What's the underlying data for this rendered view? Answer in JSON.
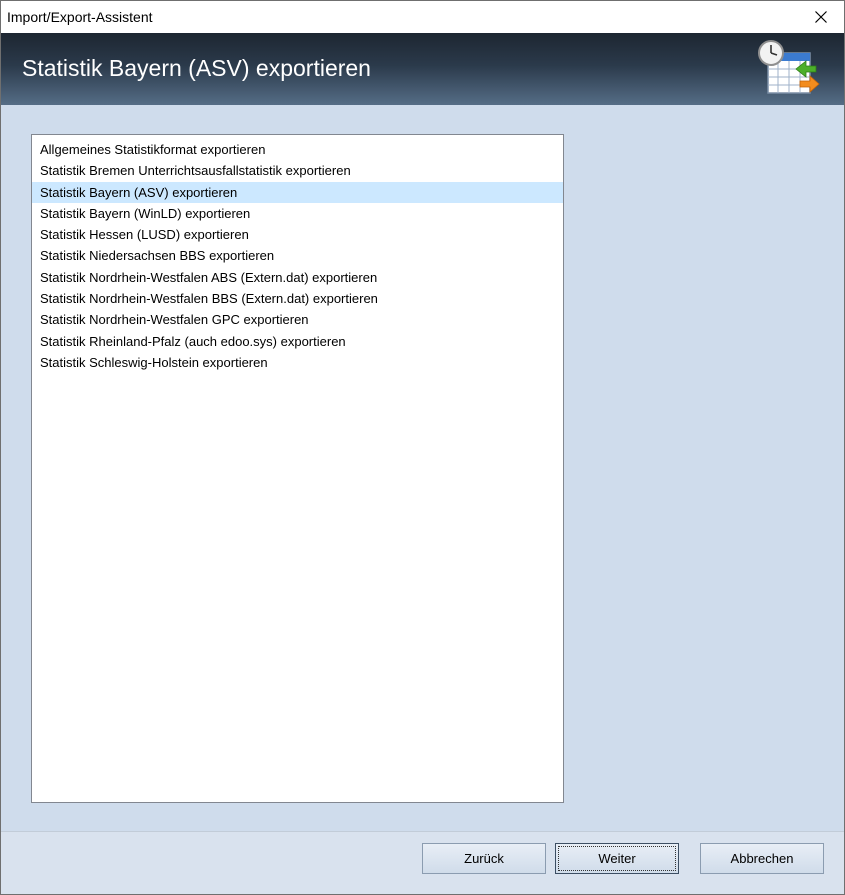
{
  "window": {
    "title": "Import/Export-Assistent",
    "close_icon": "close-icon"
  },
  "header": {
    "heading": "Statistik Bayern (ASV) exportieren",
    "icon": "calendar-clock-export-icon"
  },
  "list": {
    "selected_index": 2,
    "items": [
      "Allgemeines Statistikformat exportieren",
      "Statistik Bremen Unterrichtsausfallstatistik exportieren",
      "Statistik Bayern (ASV) exportieren",
      "Statistik Bayern (WinLD) exportieren",
      "Statistik Hessen (LUSD) exportieren",
      "Statistik Niedersachsen BBS exportieren",
      "Statistik Nordrhein-Westfalen ABS (Extern.dat) exportieren",
      "Statistik Nordrhein-Westfalen BBS (Extern.dat) exportieren",
      "Statistik Nordrhein-Westfalen GPC exportieren",
      "Statistik Rheinland-Pfalz (auch edoo.sys) exportieren",
      "Statistik Schleswig-Holstein exportieren"
    ]
  },
  "buttons": {
    "back": "Zurück",
    "next": "Weiter",
    "cancel": "Abbrechen"
  }
}
